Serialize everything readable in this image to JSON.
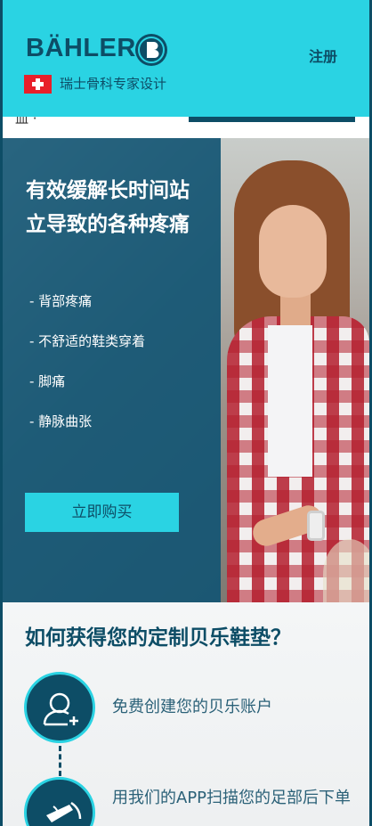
{
  "header": {
    "brand": "BÄHLER",
    "tagline": "瑞士骨科专家设计",
    "register_label": "注册",
    "accent_color": "#2ad3e3",
    "brand_color": "#0d4d66"
  },
  "sliver": {
    "text": "皿 ·"
  },
  "hero": {
    "title": "有效缓解长时间站立导致的各种疼痛",
    "items": [
      "- 背部疼痛",
      "- 不舒适的鞋类穿着",
      "- 脚痛",
      "- 静脉曲张"
    ],
    "buy_label": "立即购买"
  },
  "how": {
    "title": "如何获得您的定制贝乐鞋垫？",
    "steps": [
      {
        "icon": "add-user-icon",
        "text": "免费创建您的贝乐账户"
      },
      {
        "icon": "scan-foot-icon",
        "text": "用我们的APP扫描您的足部后下单"
      }
    ]
  }
}
